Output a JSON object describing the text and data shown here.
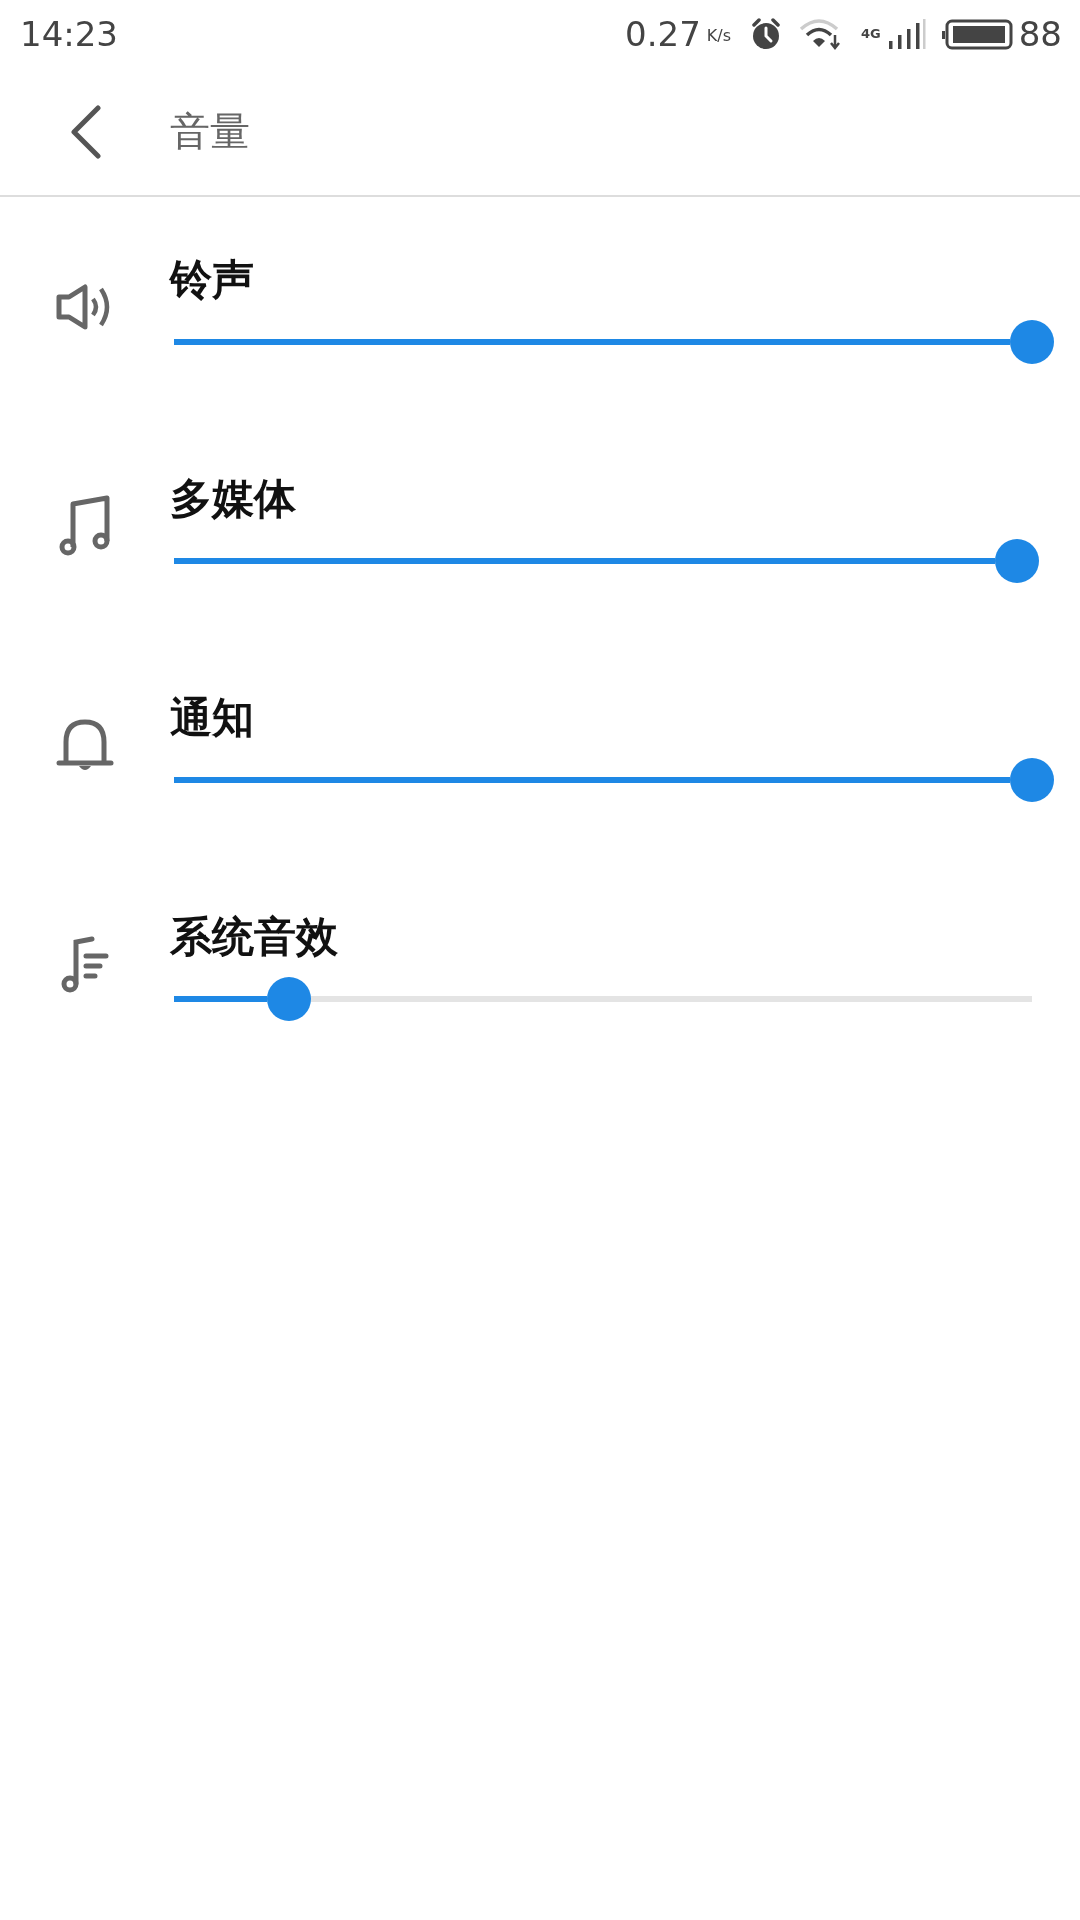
{
  "status_bar": {
    "time": "14:23",
    "speed": "0.27",
    "speed_unit": "K/s",
    "network": "4G",
    "battery": "88"
  },
  "header": {
    "title": "音量"
  },
  "channels": [
    {
      "kind": "ringtone",
      "name": "铃声",
      "level": 1.0
    },
    {
      "kind": "media",
      "name": "多媒体",
      "level": 0.983
    },
    {
      "kind": "notification",
      "name": "通知",
      "level": 1.0
    },
    {
      "kind": "system",
      "name": "系统音效",
      "level": 0.134
    }
  ]
}
